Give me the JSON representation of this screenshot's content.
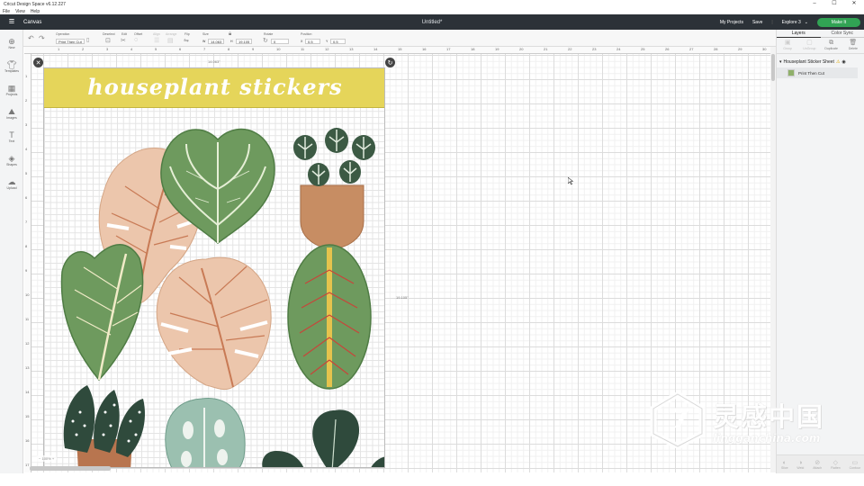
{
  "window": {
    "title": "Cricut Design Space  v6.12.227",
    "controls": [
      "–",
      "☐",
      "✕"
    ]
  },
  "menu": {
    "items": [
      "File",
      "View",
      "Help"
    ]
  },
  "header": {
    "section": "Canvas",
    "doc_title": "Untitled*",
    "my_projects": "My Projects",
    "save": "Save",
    "machine": "Explore 3",
    "make": "Make It"
  },
  "toolbar": {
    "operation_label": "Operation",
    "operation_value": "Print Then Cut",
    "deselect_label": "Deselect",
    "edit_label": "Edit",
    "offset_label": "Offset",
    "align_label": "Align",
    "arrange_label": "Arrange",
    "flip_label": "Flip",
    "size_label": "Size",
    "size_w_prefix": "W",
    "size_w": "14.063",
    "size_h_prefix": "H",
    "size_h": "19.105",
    "rotate_label": "Rotate",
    "rotate_value": "0",
    "position_label": "Position",
    "pos_x_prefix": "X",
    "pos_x": "0.5",
    "pos_y_prefix": "Y",
    "pos_y": "0.5"
  },
  "leftbar": {
    "items": [
      {
        "label": "New",
        "icon": "plus-icon"
      },
      {
        "label": "Templates",
        "icon": "shirt-icon"
      },
      {
        "label": "Projects",
        "icon": "projects-icon"
      },
      {
        "label": "Images",
        "icon": "images-icon"
      },
      {
        "label": "Text",
        "icon": "text-icon"
      },
      {
        "label": "Shapes",
        "icon": "shapes-icon"
      },
      {
        "label": "Upload",
        "icon": "upload-icon"
      }
    ]
  },
  "rulers": {
    "top": [
      "1",
      "2",
      "3",
      "4",
      "5",
      "6",
      "7",
      "8",
      "9",
      "10",
      "11",
      "12",
      "13",
      "14",
      "15",
      "16",
      "17",
      "18",
      "19",
      "20",
      "21",
      "22",
      "23",
      "24",
      "25",
      "26",
      "27",
      "28",
      "29",
      "30"
    ],
    "left": [
      "1",
      "2",
      "3",
      "4",
      "5",
      "6",
      "7",
      "8",
      "9",
      "10",
      "11",
      "12",
      "13",
      "14",
      "15",
      "16",
      "17"
    ]
  },
  "canvas": {
    "sheet_title": "houseplant stickers",
    "width_label": "14.063\"",
    "height_label": "19.105\"",
    "zoom": "100%"
  },
  "right_panel": {
    "tabs": [
      "Layers",
      "Color Sync"
    ],
    "actions": [
      {
        "label": "Group",
        "enabled": false
      },
      {
        "label": "UnGroup",
        "enabled": false
      },
      {
        "label": "Duplicate",
        "enabled": true
      },
      {
        "label": "Delete",
        "enabled": true
      }
    ],
    "group_name": "Houseplant Sticker Sheet",
    "layer_name": "Print Then Cut",
    "bottom_actions": [
      "Slice",
      "Weld",
      "Attach",
      "Flatten",
      "Contour"
    ]
  },
  "watermark": {
    "cn": "灵感中国",
    "en": "lingganchina.com"
  },
  "colors": {
    "header": "#2c3238",
    "make": "#31a354",
    "banner": "#e5d55a"
  }
}
